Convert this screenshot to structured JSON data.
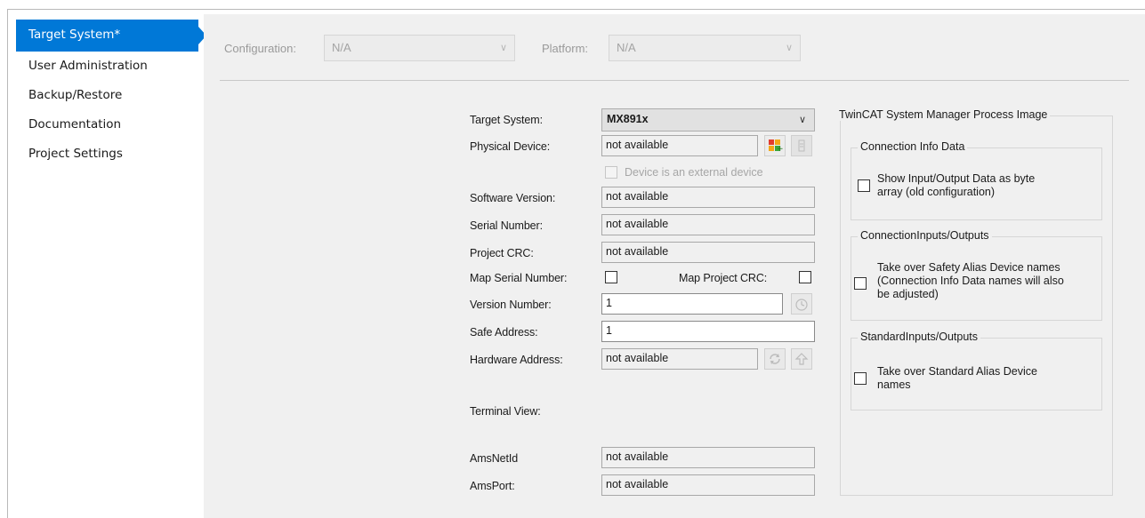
{
  "sidebar": {
    "items": [
      {
        "label": "Target System*"
      },
      {
        "label": "User Administration"
      },
      {
        "label": "Backup/Restore"
      },
      {
        "label": "Documentation"
      },
      {
        "label": "Project Settings"
      }
    ]
  },
  "toolbar": {
    "configuration_label": "Configuration:",
    "configuration_value": "N/A",
    "platform_label": "Platform:",
    "platform_value": "N/A"
  },
  "form": {
    "target_system_label": "Target System:",
    "target_system_value": "MX891x",
    "physical_device_label": "Physical Device:",
    "physical_device_value": "not available",
    "external_device_label": "Device is an external device",
    "software_version_label": "Software Version:",
    "software_version_value": "not available",
    "serial_number_label": "Serial Number:",
    "serial_number_value": "not available",
    "project_crc_label": "Project CRC:",
    "project_crc_value": "not available",
    "map_serial_label": "Map Serial Number:",
    "map_crc_label": "Map Project CRC:",
    "version_number_label": "Version Number:",
    "version_number_value": "1",
    "safe_address_label": "Safe Address:",
    "safe_address_value": "1",
    "hardware_address_label": "Hardware Address:",
    "hardware_address_value": "not available",
    "terminal_view_label": "Terminal View:",
    "ams_netid_label": "AmsNetId",
    "ams_netid_value": "not available",
    "ams_port_label": "AmsPort:",
    "ams_port_value": "not available"
  },
  "process_image": {
    "title": "TwinCAT System Manager Process Image",
    "connection_info": {
      "title": "Connection Info Data",
      "option_line1": "Show Input/Output Data as byte",
      "option_line2": "array (old configuration)"
    },
    "connection_io": {
      "title": "ConnectionInputs/Outputs",
      "option_line1": "Take over Safety Alias Device names",
      "option_line2": "(Connection Info Data names will also",
      "option_line3": "be adjusted)"
    },
    "standard_io": {
      "title": "StandardInputs/Outputs",
      "option_line1": "Take over Standard Alias Device",
      "option_line2": "names"
    }
  },
  "colors": {
    "accent": "#0078d7",
    "panel_bg": "#f0f0f0"
  }
}
